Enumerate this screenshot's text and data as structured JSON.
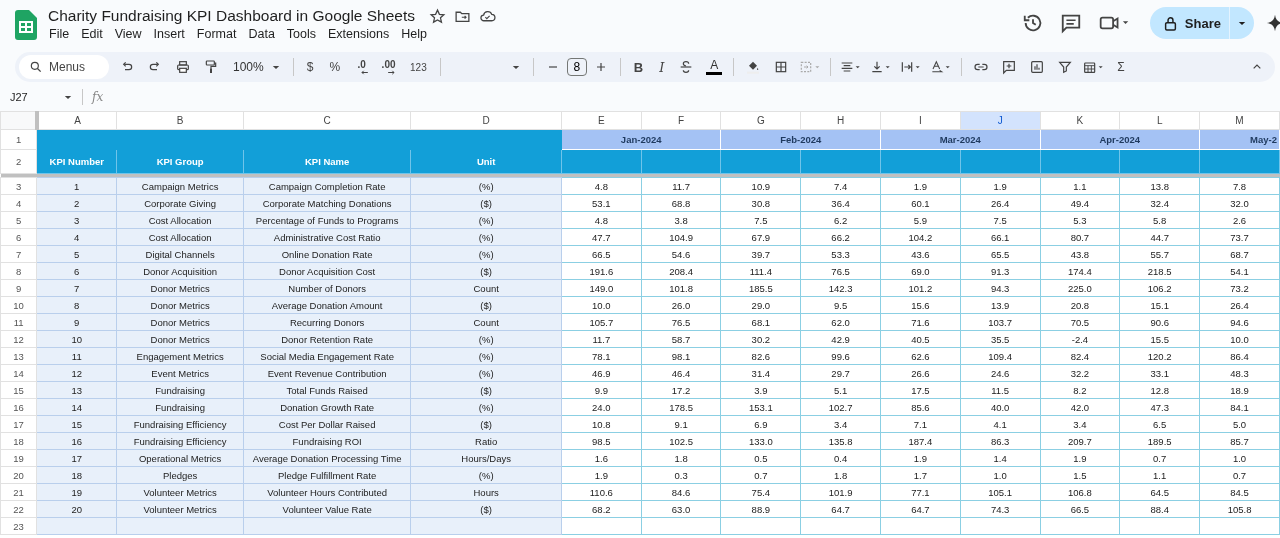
{
  "document": {
    "title": "Charity Fundraising KPI Dashboard in Google Sheets",
    "menus": [
      "File",
      "Edit",
      "View",
      "Insert",
      "Format",
      "Data",
      "Tools",
      "Extensions",
      "Help"
    ]
  },
  "header_actions": {
    "share_label": "Share"
  },
  "toolbar": {
    "search_placeholder": "Menus",
    "zoom": "100%",
    "number_formats": [
      ".0",
      ".00"
    ],
    "currency": "$",
    "percent": "%",
    "more_formats": "123",
    "font_size": "8",
    "text_styles": [
      "B",
      "I"
    ],
    "text_color_label": "A",
    "functions_label": "Σ"
  },
  "formula_bar": {
    "name_box": "J27",
    "fx_label": "fx"
  },
  "sheet": {
    "columns": [
      {
        "letter": "A",
        "selected": false
      },
      {
        "letter": "B",
        "selected": false
      },
      {
        "letter": "C",
        "selected": false
      },
      {
        "letter": "D",
        "selected": false
      },
      {
        "letter": "E",
        "selected": false
      },
      {
        "letter": "F",
        "selected": false
      },
      {
        "letter": "G",
        "selected": false
      },
      {
        "letter": "H",
        "selected": false
      },
      {
        "letter": "I",
        "selected": false
      },
      {
        "letter": "J",
        "selected": true
      },
      {
        "letter": "K",
        "selected": false
      },
      {
        "letter": "L",
        "selected": false
      },
      {
        "letter": "M",
        "selected": false
      }
    ],
    "header_row_numbers": [
      "1",
      "2"
    ],
    "months": [
      "Jan-2024",
      "Feb-2024",
      "Mar-2024",
      "Apr-2024",
      "May-2"
    ],
    "headers": [
      "KPI Number",
      "KPI Group",
      "KPI Name",
      "Unit"
    ],
    "rows": [
      {
        "row": "3",
        "number": "1",
        "group": "Campaign Metrics",
        "name": "Campaign Completion Rate",
        "unit": "(%)",
        "values": [
          "4.8",
          "11.7",
          "10.9",
          "7.4",
          "1.9",
          "1.9",
          "1.1",
          "13.8",
          "7.8"
        ]
      },
      {
        "row": "4",
        "number": "2",
        "group": "Corporate Giving",
        "name": "Corporate Matching Donations",
        "unit": "($)",
        "values": [
          "53.1",
          "68.8",
          "30.8",
          "36.4",
          "60.1",
          "26.4",
          "49.4",
          "32.4",
          "32.0"
        ]
      },
      {
        "row": "5",
        "number": "3",
        "group": "Cost Allocation",
        "name": "Percentage of Funds to Programs",
        "unit": "(%)",
        "values": [
          "4.8",
          "3.8",
          "7.5",
          "6.2",
          "5.9",
          "7.5",
          "5.3",
          "5.8",
          "2.6"
        ]
      },
      {
        "row": "6",
        "number": "4",
        "group": "Cost Allocation",
        "name": "Administrative Cost Ratio",
        "unit": "(%)",
        "values": [
          "47.7",
          "104.9",
          "67.9",
          "66.2",
          "104.2",
          "66.1",
          "80.7",
          "44.7",
          "73.7"
        ]
      },
      {
        "row": "7",
        "number": "5",
        "group": "Digital Channels",
        "name": "Online Donation Rate",
        "unit": "(%)",
        "values": [
          "66.5",
          "54.6",
          "39.7",
          "53.3",
          "43.6",
          "65.5",
          "43.8",
          "55.7",
          "68.7"
        ]
      },
      {
        "row": "8",
        "number": "6",
        "group": "Donor Acquisition",
        "name": "Donor Acquisition Cost",
        "unit": "($)",
        "values": [
          "191.6",
          "208.4",
          "111.4",
          "76.5",
          "69.0",
          "91.3",
          "174.4",
          "218.5",
          "54.1"
        ]
      },
      {
        "row": "9",
        "number": "7",
        "group": "Donor Metrics",
        "name": "Number of Donors",
        "unit": "Count",
        "values": [
          "149.0",
          "101.8",
          "185.5",
          "142.3",
          "101.2",
          "94.3",
          "225.0",
          "106.2",
          "73.2"
        ]
      },
      {
        "row": "10",
        "number": "8",
        "group": "Donor Metrics",
        "name": "Average Donation Amount",
        "unit": "($)",
        "values": [
          "10.0",
          "26.0",
          "29.0",
          "9.5",
          "15.6",
          "13.9",
          "20.8",
          "15.1",
          "26.4"
        ]
      },
      {
        "row": "11",
        "number": "9",
        "group": "Donor Metrics",
        "name": "Recurring Donors",
        "unit": "Count",
        "values": [
          "105.7",
          "76.5",
          "68.1",
          "62.0",
          "71.6",
          "103.7",
          "70.5",
          "90.6",
          "94.6"
        ]
      },
      {
        "row": "12",
        "number": "10",
        "group": "Donor Metrics",
        "name": "Donor Retention Rate",
        "unit": "(%)",
        "values": [
          "11.7",
          "58.7",
          "30.2",
          "42.9",
          "40.5",
          "35.5",
          "-2.4",
          "15.5",
          "10.0"
        ]
      },
      {
        "row": "13",
        "number": "11",
        "group": "Engagement Metrics",
        "name": "Social Media Engagement Rate",
        "unit": "(%)",
        "values": [
          "78.1",
          "98.1",
          "82.6",
          "99.6",
          "62.6",
          "109.4",
          "82.4",
          "120.2",
          "86.4"
        ]
      },
      {
        "row": "14",
        "number": "12",
        "group": "Event Metrics",
        "name": "Event Revenue Contribution",
        "unit": "(%)",
        "values": [
          "46.9",
          "46.4",
          "31.4",
          "29.7",
          "26.6",
          "24.6",
          "32.2",
          "33.1",
          "48.3"
        ]
      },
      {
        "row": "15",
        "number": "13",
        "group": "Fundraising",
        "name": "Total Funds Raised",
        "unit": "($)",
        "values": [
          "9.9",
          "17.2",
          "3.9",
          "5.1",
          "17.5",
          "11.5",
          "8.2",
          "12.8",
          "18.9"
        ]
      },
      {
        "row": "16",
        "number": "14",
        "group": "Fundraising",
        "name": "Donation Growth Rate",
        "unit": "(%)",
        "values": [
          "24.0",
          "178.5",
          "153.1",
          "102.7",
          "85.6",
          "40.0",
          "42.0",
          "47.3",
          "84.1"
        ]
      },
      {
        "row": "17",
        "number": "15",
        "group": "Fundraising Efficiency",
        "name": "Cost Per Dollar Raised",
        "unit": "($)",
        "values": [
          "10.8",
          "9.1",
          "6.9",
          "3.4",
          "7.1",
          "4.1",
          "3.4",
          "6.5",
          "5.0"
        ]
      },
      {
        "row": "18",
        "number": "16",
        "group": "Fundraising Efficiency",
        "name": "Fundraising ROI",
        "unit": "Ratio",
        "values": [
          "98.5",
          "102.5",
          "133.0",
          "135.8",
          "187.4",
          "86.3",
          "209.7",
          "189.5",
          "85.7"
        ]
      },
      {
        "row": "19",
        "number": "17",
        "group": "Operational Metrics",
        "name": "Average Donation Processing Time",
        "unit": "Hours/Days",
        "values": [
          "1.6",
          "1.8",
          "0.5",
          "0.4",
          "1.9",
          "1.4",
          "1.9",
          "0.7",
          "1.0"
        ]
      },
      {
        "row": "20",
        "number": "18",
        "group": "Pledges",
        "name": "Pledge Fulfillment Rate",
        "unit": "(%)",
        "values": [
          "1.9",
          "0.3",
          "0.7",
          "1.8",
          "1.7",
          "1.0",
          "1.5",
          "1.1",
          "0.7"
        ]
      },
      {
        "row": "21",
        "number": "19",
        "group": "Volunteer Metrics",
        "name": "Volunteer Hours Contributed",
        "unit": "Hours",
        "values": [
          "110.6",
          "84.6",
          "75.4",
          "101.9",
          "77.1",
          "105.1",
          "106.8",
          "64.5",
          "84.5"
        ]
      },
      {
        "row": "22",
        "number": "20",
        "group": "Volunteer Metrics",
        "name": "Volunteer Value Rate",
        "unit": "($)",
        "values": [
          "68.2",
          "63.0",
          "88.9",
          "64.7",
          "64.7",
          "74.3",
          "66.5",
          "88.4",
          "105.8"
        ]
      }
    ],
    "empty_rows": [
      "23"
    ]
  }
}
